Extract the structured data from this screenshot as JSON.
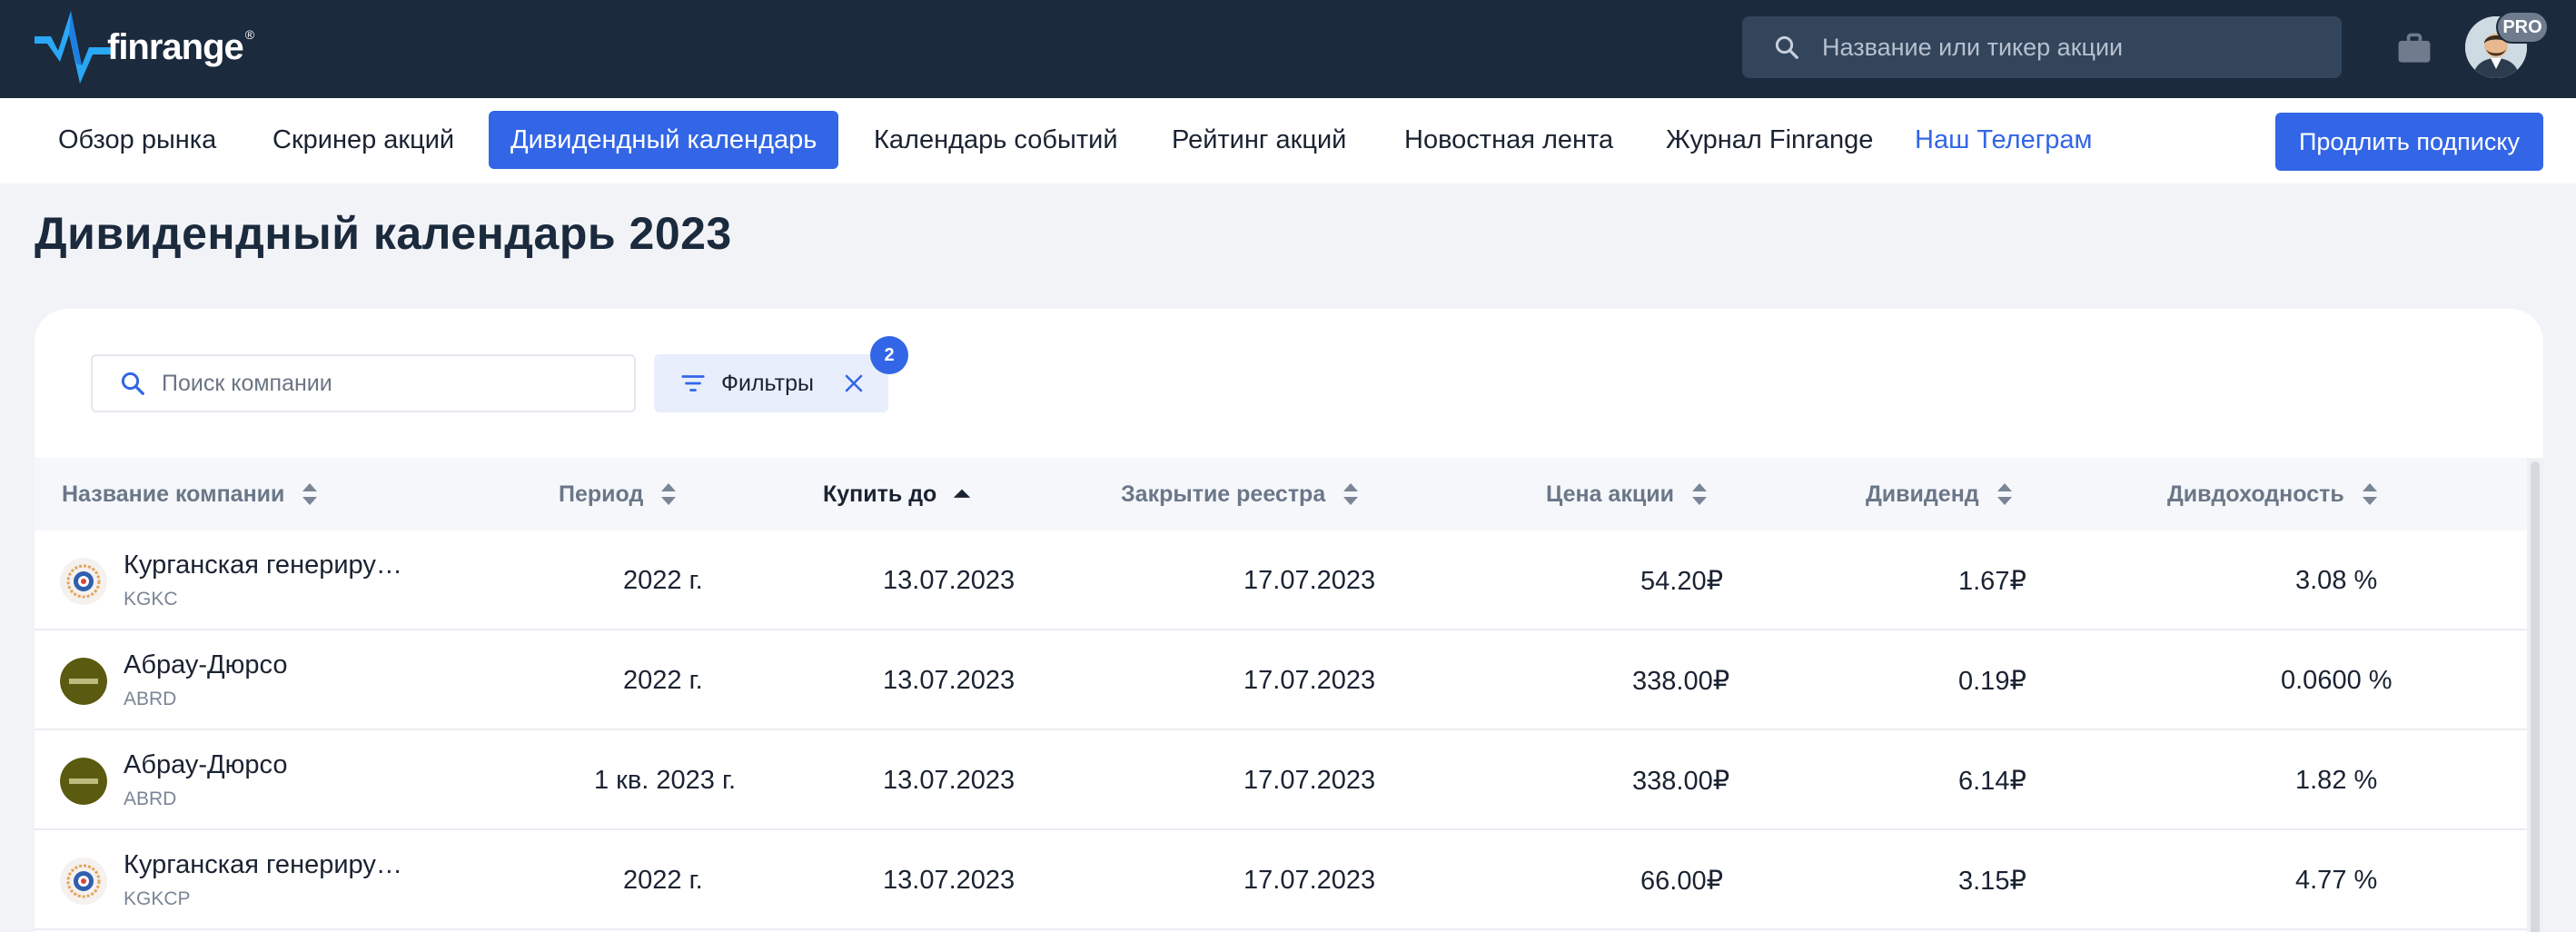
{
  "header": {
    "brand": "finrange",
    "brand_mark": "®",
    "search_placeholder": "Название или тикер акции",
    "pro_badge": "PRO"
  },
  "nav": {
    "items": [
      {
        "label": "Обзор рынка"
      },
      {
        "label": "Скринер акций"
      },
      {
        "label": "Дивидендный календарь"
      },
      {
        "label": "Календарь событий"
      },
      {
        "label": "Рейтинг акций"
      },
      {
        "label": "Новостная лента"
      },
      {
        "label": "Журнал Finrange"
      },
      {
        "label": "Наш Телеграм"
      }
    ],
    "active_index": 2,
    "renew_label": "Продлить подписку"
  },
  "page": {
    "title": "Дивидендный календарь 2023",
    "company_search_placeholder": "Поиск компании",
    "filters_label": "Фильтры",
    "filters_count": "2"
  },
  "table": {
    "columns": [
      {
        "label": "Название компании",
        "sort": "none"
      },
      {
        "label": "Период",
        "sort": "none"
      },
      {
        "label": "Купить до",
        "sort": "asc"
      },
      {
        "label": "Закрытие реестра",
        "sort": "none"
      },
      {
        "label": "Цена акции",
        "sort": "none"
      },
      {
        "label": "Дивиденд",
        "sort": "none"
      },
      {
        "label": "Дивдоходность",
        "sort": "none"
      }
    ],
    "rows": [
      {
        "name": "Курганская генериру…",
        "ticker": "KGKC",
        "period": "2022 г.",
        "buy_before": "13.07.2023",
        "registry_close": "17.07.2023",
        "price": "54.20₽",
        "dividend": "1.67₽",
        "yield": "3.08 %",
        "logo": "kurgan-logo"
      },
      {
        "name": "Абрау-Дюрсо",
        "ticker": "ABRD",
        "period": "2022 г.",
        "buy_before": "13.07.2023",
        "registry_close": "17.07.2023",
        "price": "338.00₽",
        "dividend": "0.19₽",
        "yield": "0.0600 %",
        "logo": "abrau-logo"
      },
      {
        "name": "Абрау-Дюрсо",
        "ticker": "ABRD",
        "period": "1 кв. 2023 г.",
        "buy_before": "13.07.2023",
        "registry_close": "17.07.2023",
        "price": "338.00₽",
        "dividend": "6.14₽",
        "yield": "1.82 %",
        "logo": "abrau-logo"
      },
      {
        "name": "Курганская генериру…",
        "ticker": "KGKCP",
        "period": "2022 г.",
        "buy_before": "13.07.2023",
        "registry_close": "17.07.2023",
        "price": "66.00₽",
        "dividend": "3.15₽",
        "yield": "4.77 %",
        "logo": "kurgan-logo"
      }
    ]
  },
  "colors": {
    "topbar": "#1b2a3d",
    "accent": "#3366e6",
    "page_bg": "#f1f3f7"
  }
}
